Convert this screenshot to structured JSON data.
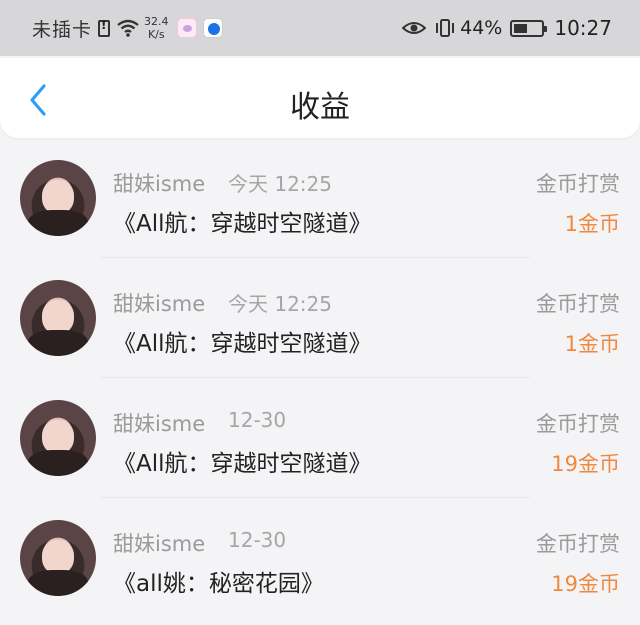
{
  "status_bar": {
    "carrier": "未插卡",
    "net_speed_value": "32.4",
    "net_speed_unit": "K/s",
    "battery_percent": "44%",
    "time": "10:27"
  },
  "header": {
    "title": "收益"
  },
  "items": [
    {
      "nickname": "甜妹isme",
      "time": "今天 12:25",
      "title": "《All航：穿越时空隧道》",
      "reward_type": "金币打赏",
      "amount": "1金币"
    },
    {
      "nickname": "甜妹isme",
      "time": "今天 12:25",
      "title": "《All航：穿越时空隧道》",
      "reward_type": "金币打赏",
      "amount": "1金币"
    },
    {
      "nickname": "甜妹isme",
      "time": "12-30",
      "title": "《All航：穿越时空隧道》",
      "reward_type": "金币打赏",
      "amount": "19金币"
    },
    {
      "nickname": "甜妹isme",
      "time": "12-30",
      "title": "《all姚：秘密花园》",
      "reward_type": "金币打赏",
      "amount": "19金币"
    }
  ],
  "colors": {
    "accent_blue": "#2f9ff5",
    "amount_orange": "#f0883e"
  }
}
